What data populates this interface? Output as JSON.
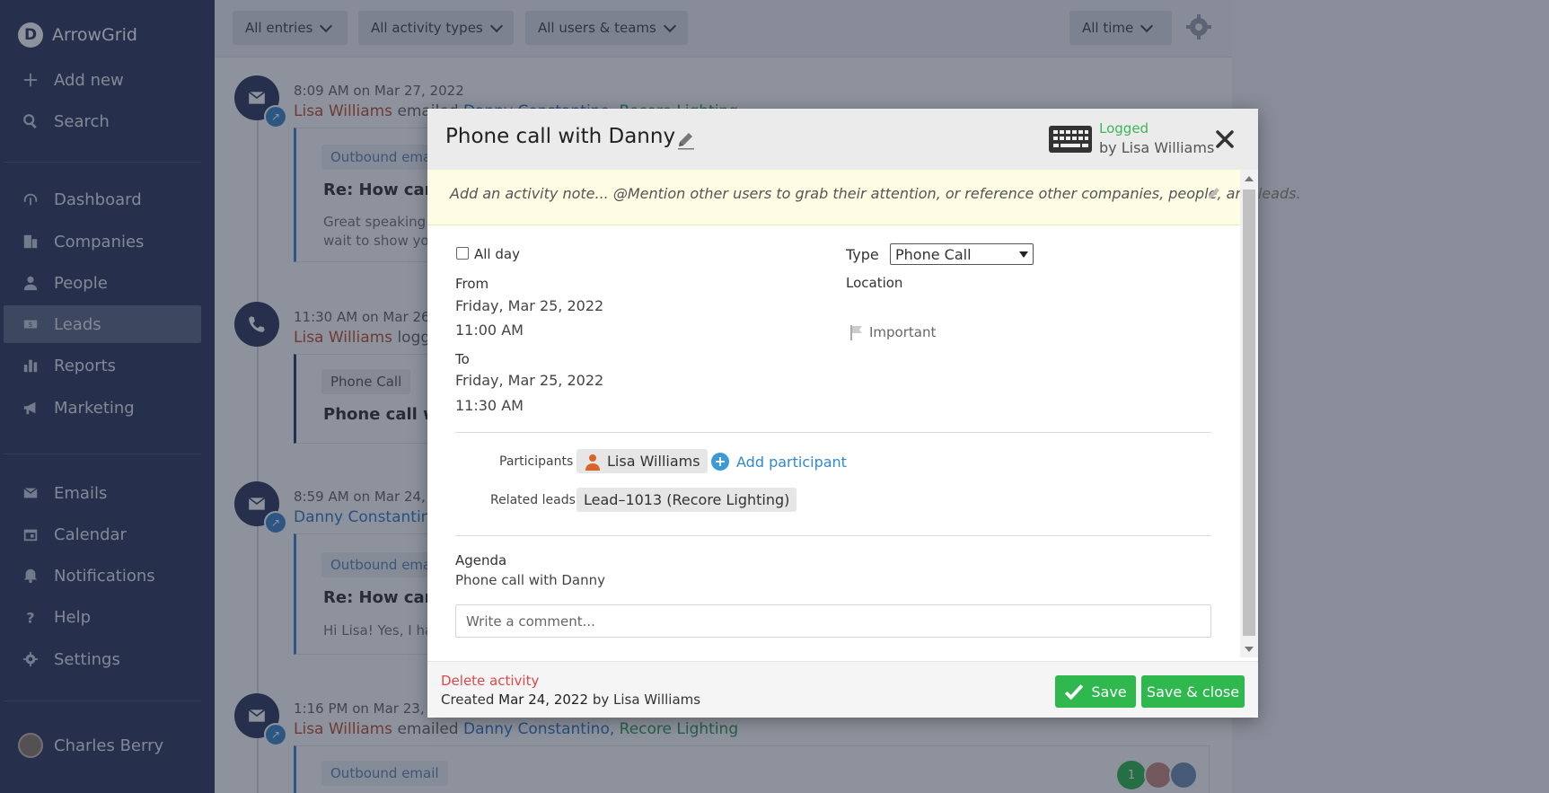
{
  "brand": {
    "logo_letter": "D",
    "name": "ArrowGrid"
  },
  "sidebar": {
    "top_items": [
      {
        "label": "Add new",
        "icon": "plus-icon"
      },
      {
        "label": "Search",
        "icon": "search-icon"
      }
    ],
    "items": [
      {
        "label": "Dashboard",
        "icon": "dashboard-icon"
      },
      {
        "label": "Companies",
        "icon": "building-icon"
      },
      {
        "label": "People",
        "icon": "person-icon"
      },
      {
        "label": "Leads",
        "icon": "money-icon",
        "active": true
      },
      {
        "label": "Reports",
        "icon": "bar-chart-icon"
      },
      {
        "label": "Marketing",
        "icon": "megaphone-icon"
      }
    ],
    "bottom_items": [
      {
        "label": "Emails",
        "icon": "envelope-icon"
      },
      {
        "label": "Calendar",
        "icon": "calendar-icon"
      },
      {
        "label": "Notifications",
        "icon": "bell-icon"
      },
      {
        "label": "Help",
        "icon": "question-icon"
      },
      {
        "label": "Settings",
        "icon": "gear-icon"
      }
    ],
    "user": {
      "name": "Charles Berry"
    }
  },
  "filters": {
    "entries": "All entries",
    "activity_types": "All activity types",
    "users_teams": "All users & teams",
    "time": "All time"
  },
  "feed": [
    {
      "time": "8:09 AM on Mar 27, 2022",
      "actor": "Lisa Williams",
      "verb": "emailed",
      "target": "Danny Constantino",
      "company": "Recore Lighting",
      "chip": "Outbound email",
      "title": "Re: How can w",
      "body": [
        "Great speaking",
        "wait to show yo"
      ]
    },
    {
      "time": "11:30 AM on Mar 26",
      "actor": "Lisa Williams",
      "verb": "logg",
      "chip": "Phone Call",
      "title": "Phone call wi"
    },
    {
      "time": "8:59 AM on Mar 24,",
      "actor": "Danny Constantin",
      "chip": "Outbound emai",
      "title": "Re: How can w",
      "body": [
        "Hi Lisa! Yes, I ha"
      ]
    },
    {
      "time": "1:16 PM on Mar 23,",
      "actor": "Lisa Williams",
      "verb": "emailed",
      "target": "Danny Constantino",
      "company": "Recore Lighting",
      "chip": "Outbound email",
      "badge_count": "1"
    }
  ],
  "modal": {
    "title": "Phone call with Danny",
    "status": "Logged",
    "status_by": "by Lisa Williams",
    "note_placeholder": "Add an activity note... @Mention other users to grab their attention, or reference other companies, people, and leads.",
    "all_day_label": "All day",
    "from_label": "From",
    "from_date": "Friday, Mar 25, 2022",
    "from_time": "11:00 AM",
    "to_label": "To",
    "to_date": "Friday, Mar 25, 2022",
    "to_time": "11:30 AM",
    "type_label": "Type",
    "type_value": "Phone Call",
    "location_label": "Location",
    "important_label": "Important",
    "participants_label": "Participants",
    "participant_name": "Lisa Williams",
    "add_participant": "Add participant",
    "related_leads_label": "Related leads",
    "related_lead": "Lead–1013 (Recore Lighting)",
    "agenda_label": "Agenda",
    "agenda_value": "Phone call with Danny",
    "comment_placeholder": "Write a comment...",
    "delete_label": "Delete activity",
    "created_prefix": "Created",
    "created_date": "Mar 24, 2022",
    "created_by_prefix": "by",
    "created_by": "Lisa Williams",
    "save_label": "Save",
    "save_close_label": "Save & close"
  },
  "colors": {
    "sidebar_bg": "#2f3b5c",
    "accent_green": "#2fb84d",
    "link_blue": "#2f8ad0",
    "danger_red": "#e04848",
    "logged_green": "#3cb65a"
  }
}
